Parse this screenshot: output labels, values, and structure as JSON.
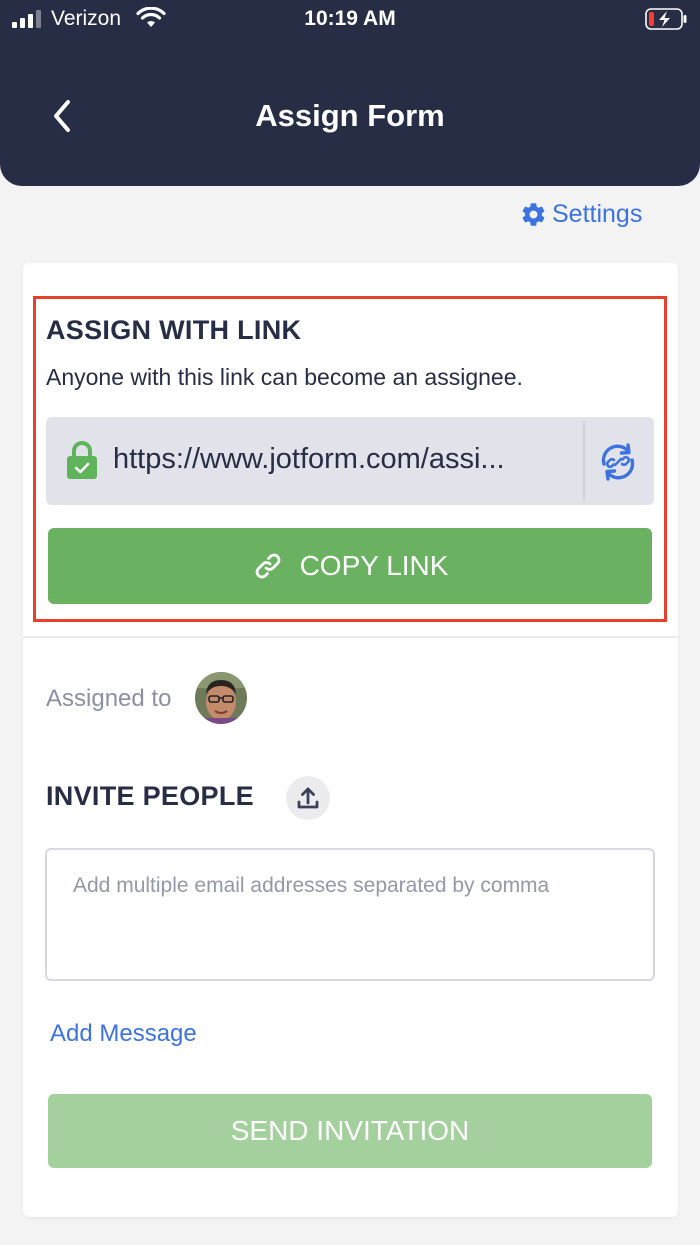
{
  "status_bar": {
    "carrier": "Verizon",
    "time": "10:19 AM",
    "battery_icon": "battery-charging-low-icon"
  },
  "header": {
    "title": "Assign Form",
    "back_icon": "chevron-left-icon"
  },
  "settings": {
    "label": "Settings",
    "icon": "gear-icon"
  },
  "assign_link": {
    "title": "ASSIGN WITH LINK",
    "description": "Anyone with this link can become an assignee.",
    "url": "https://www.jotform.com/assi...",
    "copy_label": "COPY LINK"
  },
  "assigned": {
    "label": "Assigned to"
  },
  "invite": {
    "title": "INVITE PEOPLE",
    "email_placeholder": "Add multiple email addresses separated by comma",
    "add_message": "Add Message",
    "send_label": "SEND INVITATION"
  },
  "colors": {
    "header_bg": "#272d45",
    "accent_blue": "#3d73e0",
    "green": "#6ab262",
    "green_disabled": "#a4d09e",
    "highlight_red": "#e8412b"
  }
}
